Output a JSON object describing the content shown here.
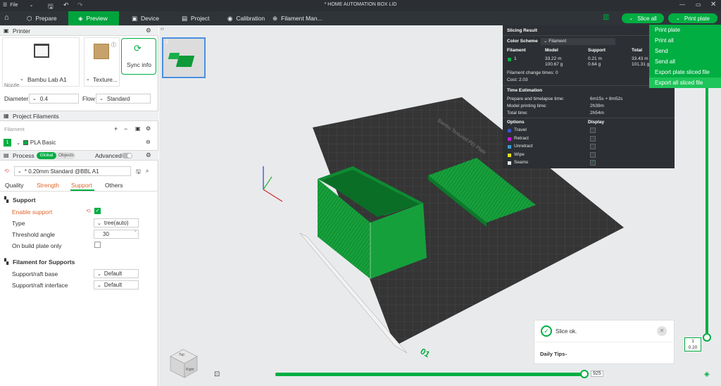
{
  "window": {
    "title": "* HOME AUTOMATION BOX LID"
  },
  "menu": {
    "file_label": "File"
  },
  "tabs": [
    {
      "label": "Prepare"
    },
    {
      "label": "Preview"
    },
    {
      "label": "Device"
    },
    {
      "label": "Project"
    },
    {
      "label": "Calibration"
    },
    {
      "label": "Filament Man..."
    }
  ],
  "toolbar": {
    "slice_all": "Slice all",
    "print_plate": "Print plate"
  },
  "dropdown": [
    "Print plate",
    "Print all",
    "Send",
    "Send all",
    "Export plate sliced file",
    "Export all sliced file"
  ],
  "printer": {
    "header": "Printer",
    "model": "Bambu Lab A1",
    "plate": "Texture...",
    "sync": "Sync info",
    "nozzle_label": "Nozzle",
    "diameter_label": "Diameter",
    "diameter_value": "0.4",
    "flow_label": "Flow",
    "flow_value": "Standard"
  },
  "filaments": {
    "header": "Project Filaments",
    "col_label": "Filament",
    "items": [
      {
        "index": "1",
        "name": "PLA Basic",
        "color": "#00ae42"
      }
    ]
  },
  "process": {
    "header": "Process",
    "global": "Global",
    "objects": "Objects",
    "advanced": "Advanced",
    "profile": "* 0.20mm Standard @BBL A1",
    "subtabs": [
      "Quality",
      "Strength",
      "Support",
      "Others"
    ],
    "support_section": "Support",
    "enable_support": "Enable support",
    "type_label": "Type",
    "type_value": "tree(auto)",
    "threshold_label": "Threshold angle",
    "threshold_value": "30",
    "threshold_unit": "°",
    "buildplate_label": "On build plate only",
    "fil_section": "Filament for Supports",
    "raft_base_label": "Support/raft base",
    "raft_base_value": "Default",
    "raft_iface_label": "Support/raft interface",
    "raft_iface_value": "Default"
  },
  "plate_thumb": {
    "number": "1"
  },
  "slicing": {
    "title": "Slicing Result",
    "color_scheme_label": "Color Scheme",
    "color_scheme_value": "Filament",
    "cols": [
      "Filament",
      "Model",
      "Support",
      "Total"
    ],
    "row": {
      "idx": "1",
      "model_len": "33.22 m",
      "model_g": "100.67 g",
      "sup_len": "0.21 m",
      "sup_g": "0.64 g",
      "tot_len": "33.43 m",
      "tot_g": "101.31 g"
    },
    "change_times": "Filament change times:  0",
    "cost": "Cost:  2.03",
    "time_title": "Time Estimation",
    "prep_label": "Prepare and timelapse time:",
    "prep_value": "6m15s + 8m52s",
    "model_time_label": "Model printing time:",
    "model_time_value": "2h39m",
    "total_label": "Total time:",
    "total_value": "2h54m",
    "options_label": "Options",
    "display_label": "Display",
    "options": [
      {
        "name": "Travel",
        "color": "#3a56c5",
        "checked": false
      },
      {
        "name": "Retract",
        "color": "#c21ad6",
        "checked": false
      },
      {
        "name": "Unretract",
        "color": "#3a9ad6",
        "checked": false
      },
      {
        "name": "Wipe",
        "color": "#e7e01a",
        "checked": false
      },
      {
        "name": "Seams",
        "color": "#e6e6e6",
        "checked": true
      }
    ]
  },
  "layer_slider": {
    "top": "1",
    "bottom": "0.20"
  },
  "h_slider": {
    "value": "925"
  },
  "toast": {
    "message": "Slice ok.",
    "tips": "Daily Tips"
  },
  "nav_cube": {
    "top": "Top",
    "right": "Right"
  }
}
